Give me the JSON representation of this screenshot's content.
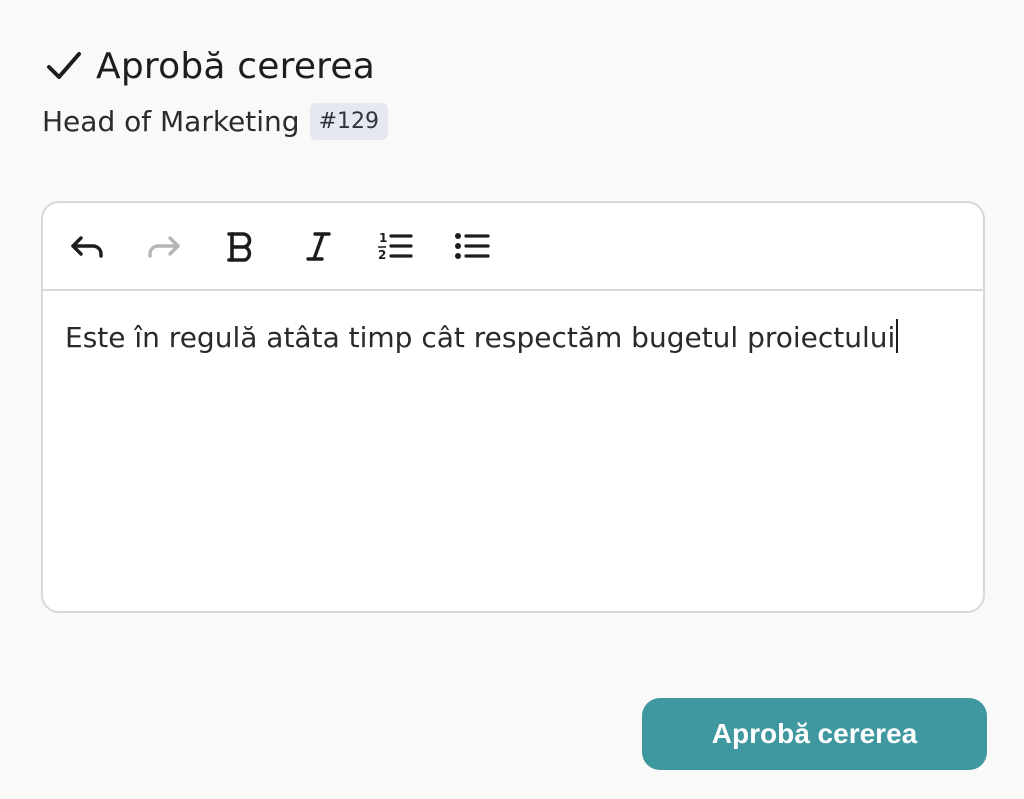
{
  "header": {
    "icon": "checkmark-icon",
    "title": "Aprobă cererea"
  },
  "subheader": {
    "role": "Head of Marketing",
    "badge": "#129"
  },
  "editor": {
    "toolbar": [
      {
        "name": "undo",
        "icon": "undo-arrow-icon",
        "enabled": true
      },
      {
        "name": "redo",
        "icon": "redo-arrow-icon",
        "enabled": false
      },
      {
        "name": "bold",
        "icon": "bold-icon",
        "enabled": true
      },
      {
        "name": "italic",
        "icon": "italic-icon",
        "enabled": true
      },
      {
        "name": "ordered-list",
        "icon": "ordered-list-icon",
        "enabled": true
      },
      {
        "name": "bullet-list",
        "icon": "bullet-list-icon",
        "enabled": true
      }
    ],
    "text": "Este în regulă atâta timp cât respectăm bugetul proiectului"
  },
  "actions": {
    "approve_label": "Aprobă cererea"
  },
  "colors": {
    "accent": "#3f979f",
    "background": "#f9f9f7",
    "badge_bg": "#e5e9ef",
    "border": "#d8d8d8",
    "disabled_icon": "#b5b5b5"
  }
}
